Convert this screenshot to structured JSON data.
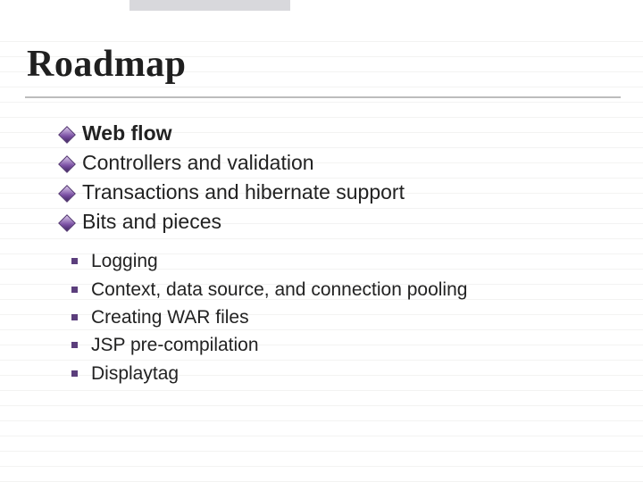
{
  "title": "Roadmap",
  "bullets": [
    {
      "text": "Web flow",
      "bold": true
    },
    {
      "text": "Controllers and validation",
      "bold": false
    },
    {
      "text": "Transactions and hibernate support",
      "bold": false
    },
    {
      "text": "Bits and pieces",
      "bold": false
    }
  ],
  "sub_bullets": [
    "Logging",
    "Context, data source, and connection pooling",
    "Creating WAR files",
    "JSP pre-compilation",
    "Displaytag"
  ]
}
